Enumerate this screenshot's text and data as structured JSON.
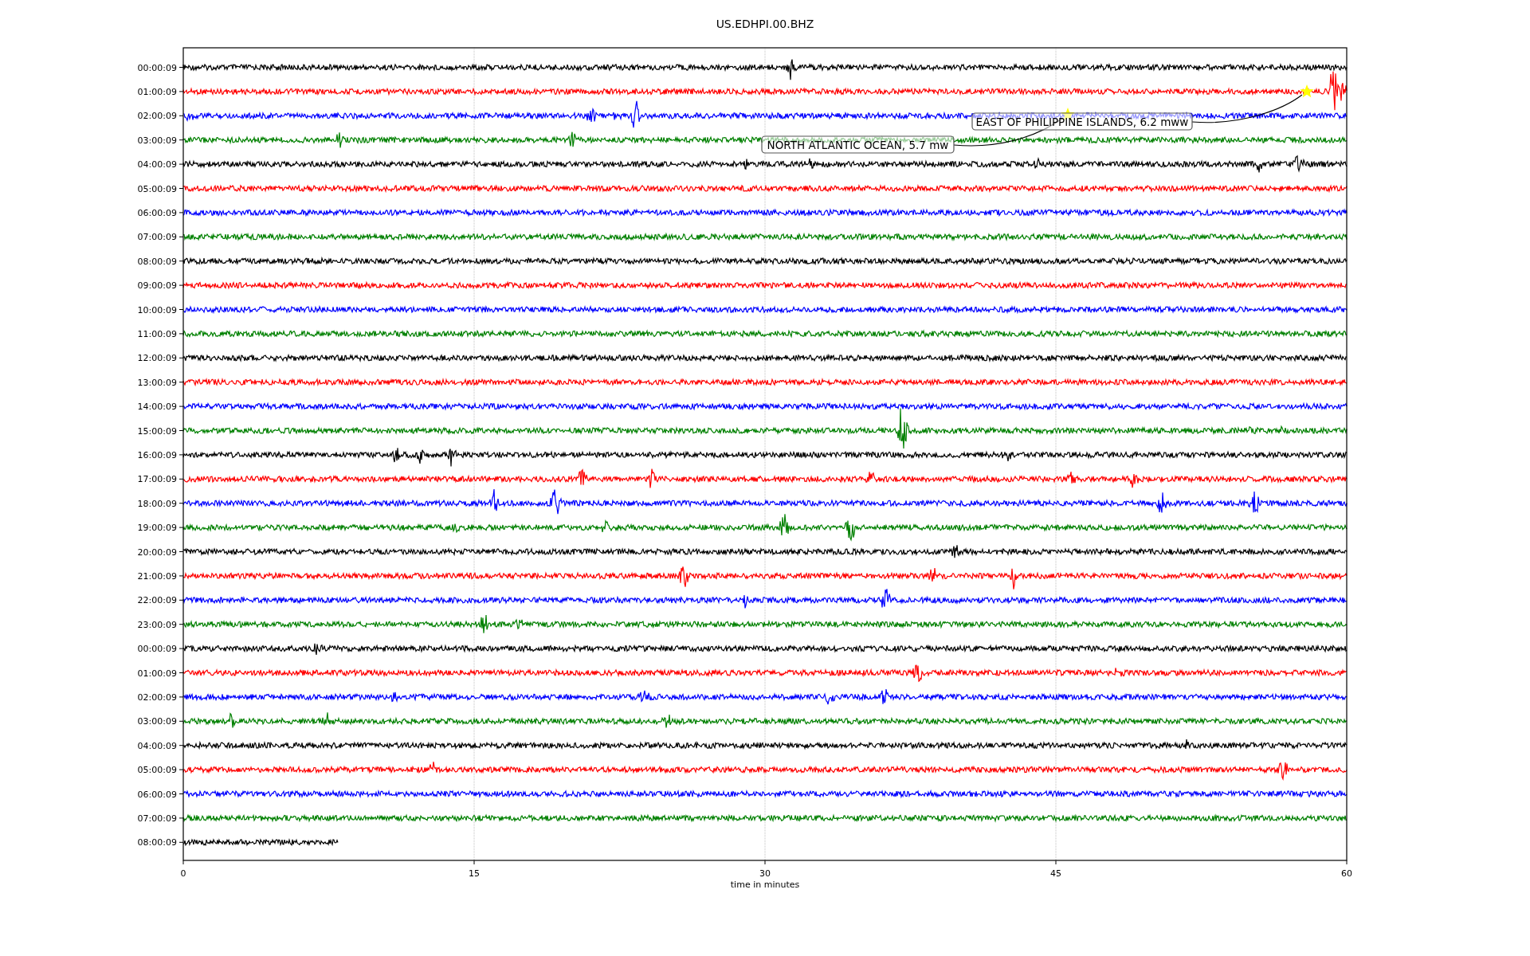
{
  "title": "US.EDHPI.00.BHZ",
  "plot": {
    "xlabel": "time in minutes",
    "xticks": [
      "0",
      "15",
      "30",
      "45",
      "60"
    ],
    "rows": [
      {
        "time": "00:00:09",
        "color": "#000000",
        "level": 1
      },
      {
        "time": "01:00:09",
        "color": "#ff0000",
        "level": 1
      },
      {
        "time": "02:00:09",
        "color": "#0000ff",
        "level": 1
      },
      {
        "time": "03:00:09",
        "color": "#008000",
        "level": 1
      },
      {
        "time": "04:00:09",
        "color": "#000000",
        "level": 1
      },
      {
        "time": "05:00:09",
        "color": "#ff0000",
        "level": 1
      },
      {
        "time": "06:00:09",
        "color": "#0000ff",
        "level": 1
      },
      {
        "time": "07:00:09",
        "color": "#008000",
        "level": 1
      },
      {
        "time": "08:00:09",
        "color": "#000000",
        "level": 1
      },
      {
        "time": "09:00:09",
        "color": "#ff0000",
        "level": 1
      },
      {
        "time": "10:00:09",
        "color": "#0000ff",
        "level": 1
      },
      {
        "time": "11:00:09",
        "color": "#008000",
        "level": 1
      },
      {
        "time": "12:00:09",
        "color": "#000000",
        "level": 1
      },
      {
        "time": "13:00:09",
        "color": "#ff0000",
        "level": 1
      },
      {
        "time": "14:00:09",
        "color": "#0000ff",
        "level": 1
      },
      {
        "time": "15:00:09",
        "color": "#008000",
        "level": 1
      },
      {
        "time": "16:00:09",
        "color": "#000000",
        "level": 1
      },
      {
        "time": "17:00:09",
        "color": "#ff0000",
        "level": 1
      },
      {
        "time": "18:00:09",
        "color": "#0000ff",
        "level": 1
      },
      {
        "time": "19:00:09",
        "color": "#008000",
        "level": 1
      },
      {
        "time": "20:00:09",
        "color": "#000000",
        "level": 1
      },
      {
        "time": "21:00:09",
        "color": "#ff0000",
        "level": 1
      },
      {
        "time": "22:00:09",
        "color": "#0000ff",
        "level": 1
      },
      {
        "time": "23:00:09",
        "color": "#008000",
        "level": 1
      },
      {
        "time": "00:00:09",
        "color": "#000000",
        "level": 1
      },
      {
        "time": "01:00:09",
        "color": "#ff0000",
        "level": 1
      },
      {
        "time": "02:00:09",
        "color": "#0000ff",
        "level": 1
      },
      {
        "time": "03:00:09",
        "color": "#008000",
        "level": 1
      },
      {
        "time": "04:00:09",
        "color": "#000000",
        "level": 1
      },
      {
        "time": "05:00:09",
        "color": "#ff0000",
        "level": 1
      },
      {
        "time": "06:00:09",
        "color": "#0000ff",
        "level": 1
      },
      {
        "time": "07:00:09",
        "color": "#008000",
        "level": 1
      },
      {
        "time": "08:00:09",
        "color": "#000000",
        "level": 0.133
      }
    ],
    "events": [
      {
        "label": "EAST OF PHILIPPINE ISLANDS, 6.2 mww"
      },
      {
        "label": "NORTH ATLANTIC OCEAN, 5.7 mw"
      }
    ]
  }
}
